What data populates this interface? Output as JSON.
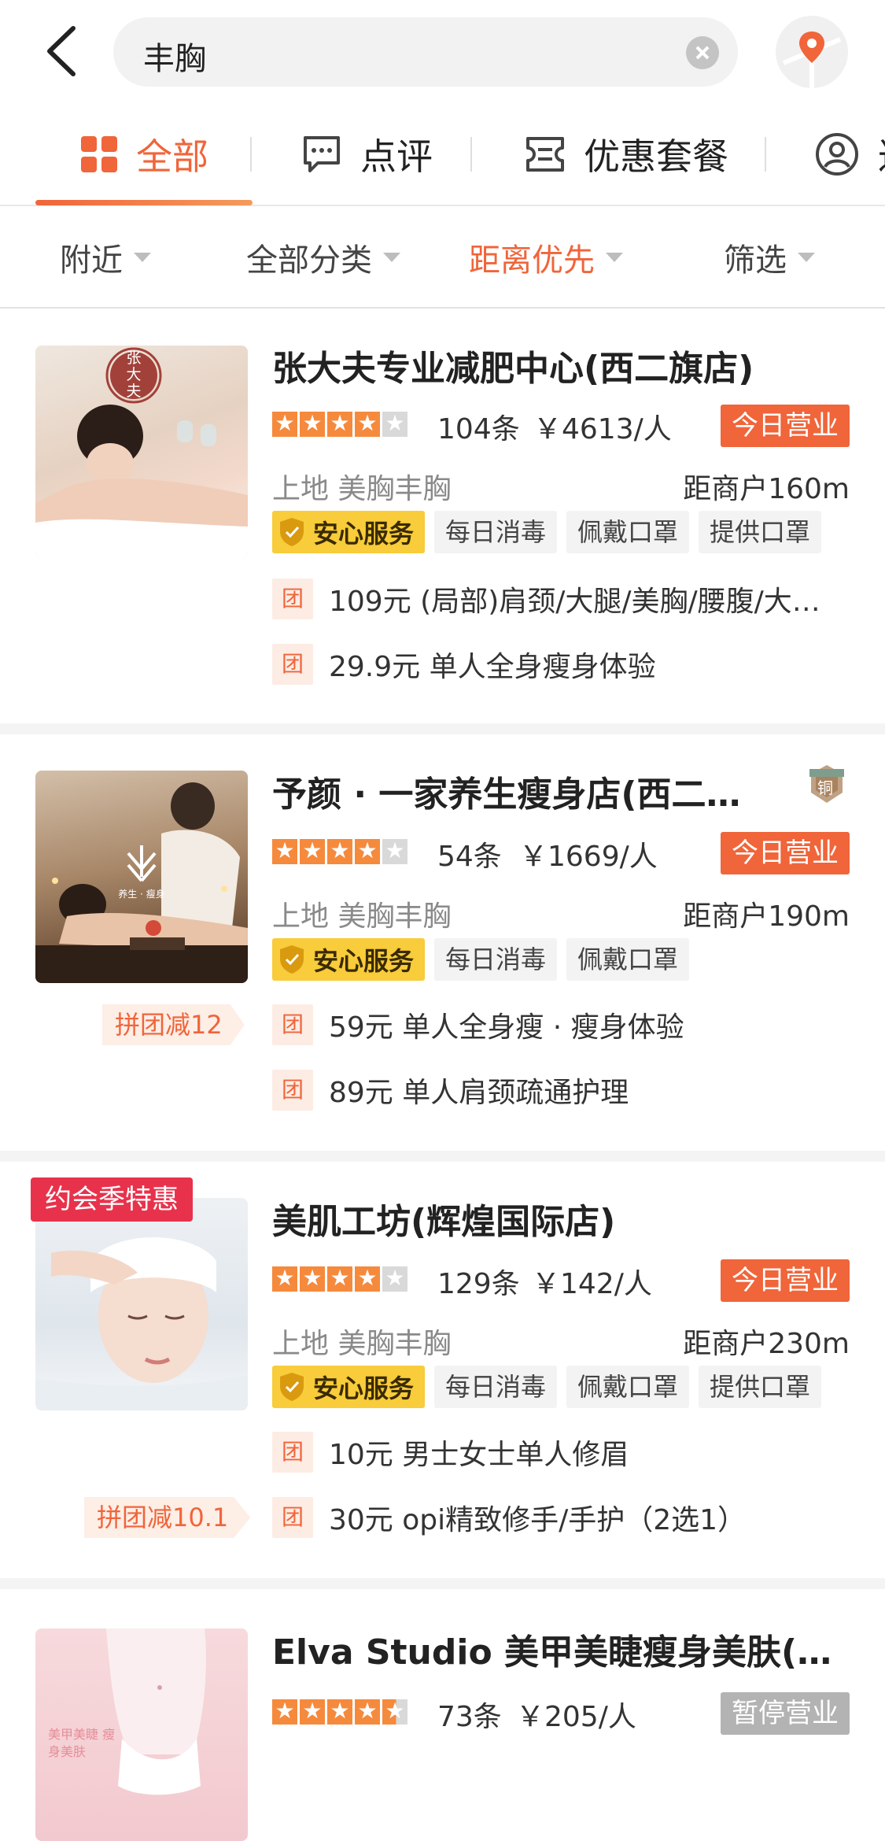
{
  "search": {
    "query": "丰胸"
  },
  "tabs": [
    {
      "label": "全部",
      "icon": "grid-icon"
    },
    {
      "label": "点评",
      "icon": "comment-icon"
    },
    {
      "label": "优惠套餐",
      "icon": "ticket-icon"
    },
    {
      "label": "达",
      "icon": "user-icon"
    }
  ],
  "filters": [
    "附近",
    "全部分类",
    "距离优先",
    "筛选"
  ],
  "shops": [
    {
      "title": "张大夫专业减肥中心(西二旗店)",
      "rating": 4,
      "reviews": "104条",
      "price": "￥4613/人",
      "status": "今日营业",
      "area": "上地  美胸丰胸",
      "distance": "距商户160m",
      "safe": "安心服务",
      "tags": [
        "每日消毒",
        "佩戴口罩",
        "提供口罩"
      ],
      "tuan": "团",
      "deals": [
        "109元 (局部)肩颈/大腿/美胸/腰腹/大…",
        "29.9元 单人全身瘦身体验"
      ],
      "thumb_text": "张大夫"
    },
    {
      "title": "予颜 · 一家养生瘦身店(西二…",
      "rating": 4,
      "reviews": "54条",
      "price": "￥1669/人",
      "status": "今日营业",
      "area": "上地  美胸丰胸",
      "distance": "距商户190m",
      "safe": "安心服务",
      "tags": [
        "每日消毒",
        "佩戴口罩"
      ],
      "group_discount": "拼团减12",
      "medal": "铜",
      "tuan": "团",
      "deals": [
        "59元 单人全身瘦 · 瘦身体验",
        "89元 单人肩颈疏通护理"
      ],
      "thumb_text": "养生 · 瘦身"
    },
    {
      "title": "美肌工坊(辉煌国际店)",
      "rating": 4,
      "reviews": "129条",
      "price": "￥142/人",
      "status": "今日营业",
      "area": "上地  美胸丰胸",
      "distance": "距商户230m",
      "safe": "安心服务",
      "tags": [
        "每日消毒",
        "佩戴口罩",
        "提供口罩"
      ],
      "promo": "约会季特惠",
      "group_discount": "拼团减10.1",
      "tuan": "团",
      "deals": [
        "10元 男士女士单人修眉",
        "30元 opi精致修手/手护（2选1）"
      ]
    },
    {
      "title": "Elva Studio 美甲美睫瘦身美肤(…",
      "rating": 4.5,
      "reviews": "73条",
      "price": "￥205/人",
      "status": "暂停营业",
      "thumb_text": "美甲美睫 瘦身美肤"
    }
  ],
  "colors": {
    "accent": "#f0653a",
    "safe_badge": "#f8cc3a",
    "promo": "#e8324c"
  }
}
